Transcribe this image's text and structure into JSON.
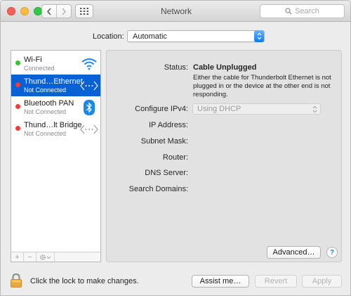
{
  "window": {
    "title": "Network"
  },
  "search": {
    "placeholder": "Search"
  },
  "location": {
    "label": "Location:",
    "value": "Automatic"
  },
  "services": [
    {
      "name": "Wi-Fi",
      "status": "Connected",
      "status_color": "green",
      "icon": "wifi-icon",
      "selected": false
    },
    {
      "name": "Thund…Ethernet",
      "status": "Not Connected",
      "status_color": "red",
      "icon": "ethernet-arrows-icon",
      "selected": true
    },
    {
      "name": "Bluetooth PAN",
      "status": "Not Connected",
      "status_color": "red",
      "icon": "bluetooth-icon",
      "selected": false
    },
    {
      "name": "Thund…lt Bridge",
      "status": "Not Connected",
      "status_color": "red",
      "icon": "ethernet-arrows-icon",
      "selected": false
    }
  ],
  "list_tools": {
    "add": "+",
    "remove": "−"
  },
  "details": {
    "status_label": "Status:",
    "status_value": "Cable Unplugged",
    "status_description": "Either the cable for Thunderbolt Ethernet is not plugged in or the device at the other end is not responding.",
    "configure_label": "Configure IPv4:",
    "configure_value": "Using DHCP",
    "ip_label": "IP Address:",
    "subnet_label": "Subnet Mask:",
    "router_label": "Router:",
    "dns_label": "DNS Server:",
    "search_domains_label": "Search Domains:",
    "advanced_label": "Advanced…",
    "help_label": "?"
  },
  "footer": {
    "lock_text": "Click the lock to make changes.",
    "assist_label": "Assist me…",
    "revert_label": "Revert",
    "apply_label": "Apply"
  },
  "colors": {
    "selection": "#0a61d4",
    "status_green": "#3fbf38",
    "status_red": "#f43b35",
    "accent_blue": "#0a7cf2"
  }
}
